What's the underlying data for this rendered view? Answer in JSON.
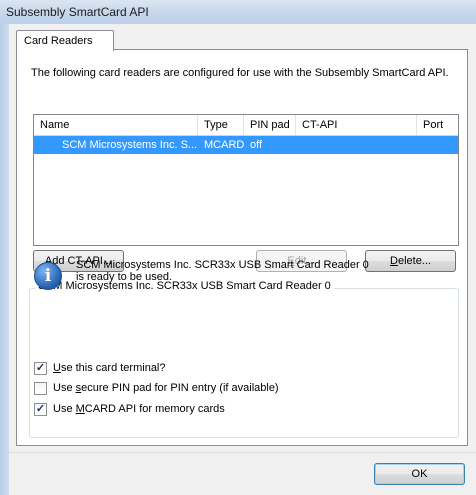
{
  "window": {
    "title": "Subsembly SmartCard API"
  },
  "tabs": [
    {
      "label": "Card Readers"
    }
  ],
  "description": "The following card readers are configured for use with the Subsembly SmartCard API.",
  "list": {
    "columns": [
      "Name",
      "Type",
      "PIN pad",
      "CT-API",
      "Port"
    ],
    "rows": [
      {
        "name": "SCM Microsystems Inc. S...",
        "type": "MCARD",
        "pin_pad": "off",
        "ct_api": "",
        "port": ""
      }
    ]
  },
  "buttons": {
    "add_ct_api": {
      "pre": "",
      "accel": "A",
      "post": "dd CT-API..."
    },
    "edit": {
      "pre": "",
      "accel": "E",
      "post": "dit..."
    },
    "delete": {
      "pre": "",
      "accel": "D",
      "post": "elete..."
    },
    "ok": "OK"
  },
  "group": {
    "title": "SCM Microsystems Inc. SCR33x USB Smart Card Reader 0",
    "info_line1": "SCM Microsystems Inc. SCR33x USB Smart Card Reader 0",
    "info_line2": "is ready to be used."
  },
  "checkboxes": [
    {
      "checked": true,
      "mark": "✓",
      "pre": "",
      "accel": "U",
      "post": "se this card terminal?"
    },
    {
      "checked": false,
      "mark": "",
      "pre": "Use ",
      "accel": "s",
      "post": "ecure PIN pad for PIN entry (if available)"
    },
    {
      "checked": true,
      "mark": "✓",
      "pre": "Use ",
      "accel": "M",
      "post": "CARD API for memory cards"
    }
  ]
}
